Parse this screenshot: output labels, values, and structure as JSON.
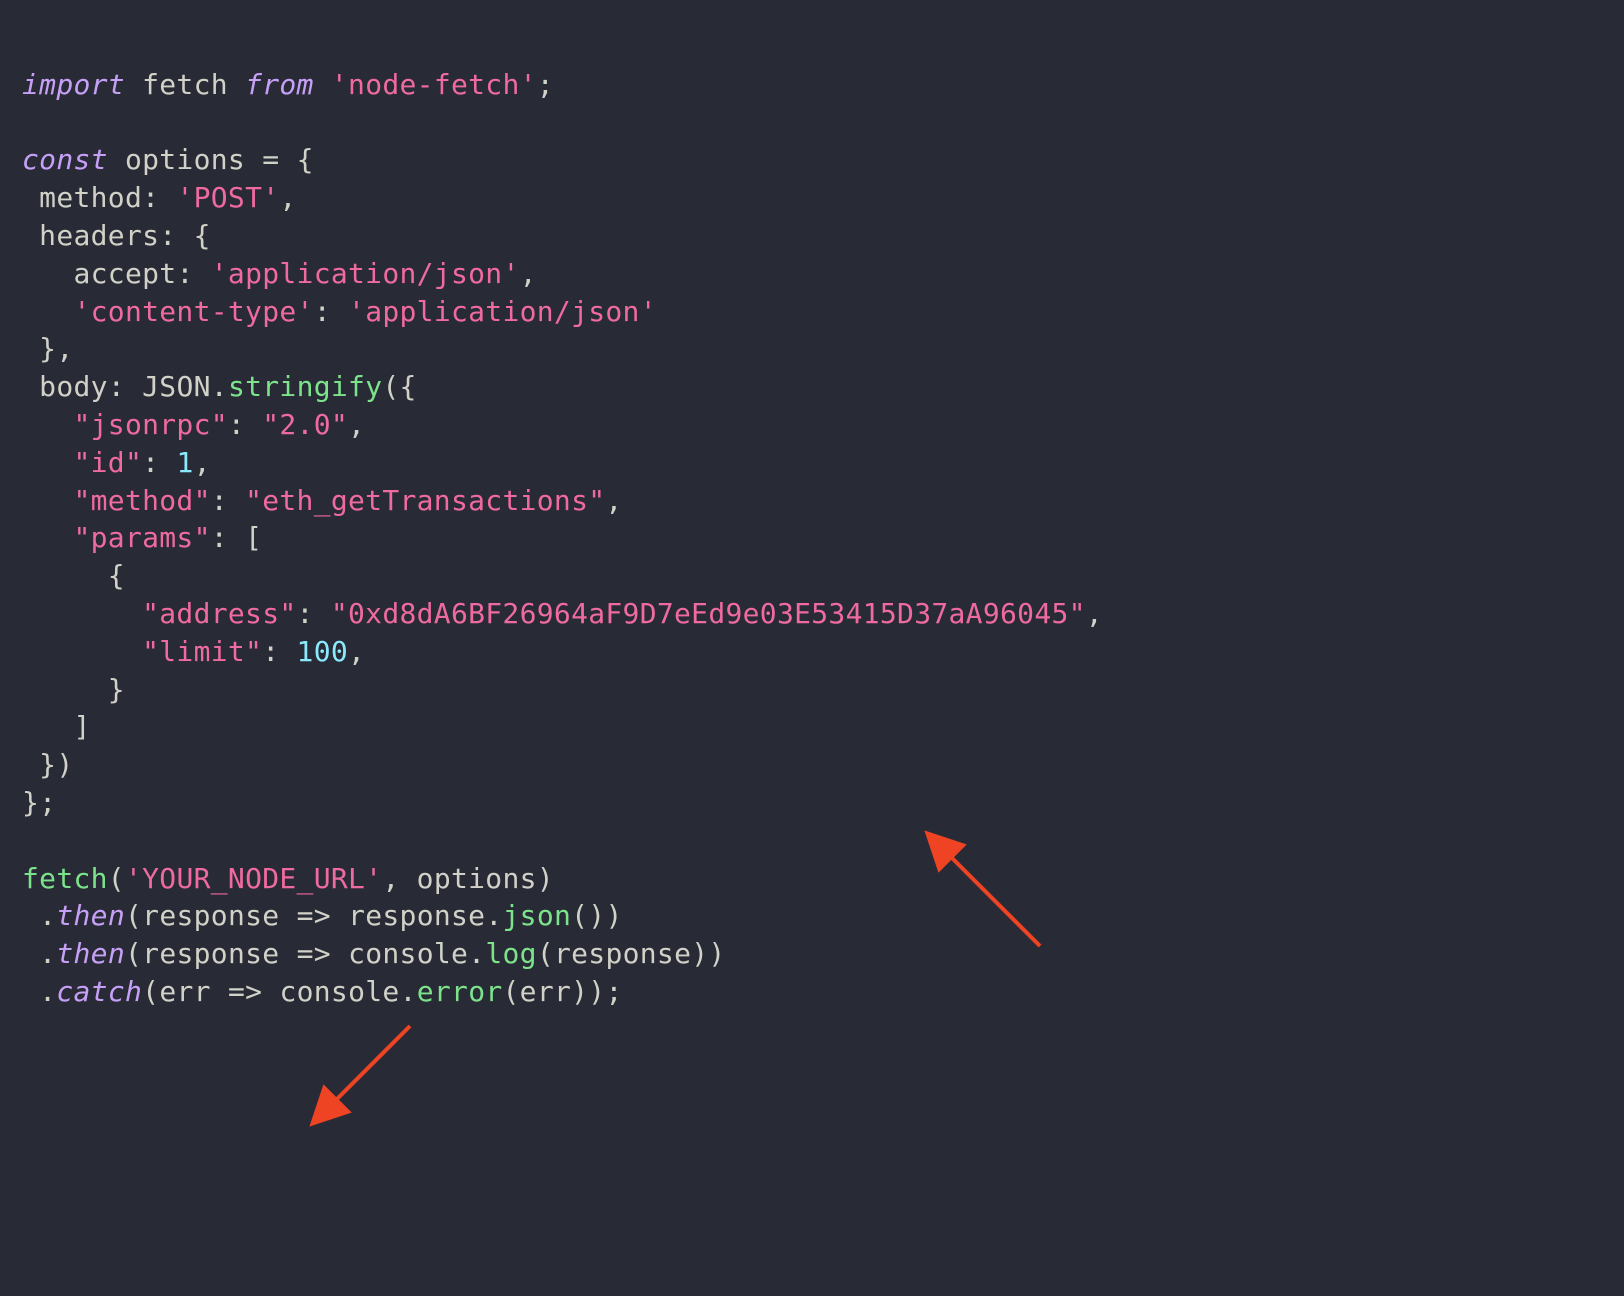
{
  "code": {
    "l1": {
      "kw": "import",
      "id": " fetch ",
      "from": "from",
      "sp": " ",
      "str": "'node-fetch'",
      "end": ";"
    },
    "l3": {
      "kw": "const",
      "id": " options ",
      "eq": "=",
      "sp": " ",
      "brace": "{"
    },
    "l4": {
      "indent": " ",
      "key": "method",
      "colon": ": ",
      "str": "'POST'",
      "comma": ","
    },
    "l5": {
      "indent": " ",
      "key": "headers",
      "colon": ": ",
      "brace": "{"
    },
    "l6": {
      "indent": "   ",
      "key": "accept",
      "colon": ": ",
      "str": "'application/json'",
      "comma": ","
    },
    "l7": {
      "indent": "   ",
      "key": "'content-type'",
      "colon": ": ",
      "str": "'application/json'"
    },
    "l8": {
      "indent": " ",
      "brace": "},",
      "": ""
    },
    "l9": {
      "indent": " ",
      "key": "body",
      "colon": ": ",
      "json": "JSON",
      "dot": ".",
      "fn": "stringify",
      "paren": "({"
    },
    "l10": {
      "indent": "   ",
      "key": "\"jsonrpc\"",
      "colon": ": ",
      "str": "\"2.0\"",
      "comma": ","
    },
    "l11": {
      "indent": "   ",
      "key": "\"id\"",
      "colon": ": ",
      "num": "1",
      "comma": ","
    },
    "l12": {
      "indent": "   ",
      "key": "\"method\"",
      "colon": ": ",
      "str": "\"eth_getTransactions\"",
      "comma": ","
    },
    "l13": {
      "indent": "   ",
      "key": "\"params\"",
      "colon": ": ",
      "bracket": "["
    },
    "l14": {
      "indent": "     ",
      "brace": "{"
    },
    "l15": {
      "indent": "       ",
      "key": "\"address\"",
      "colon": ": ",
      "str": "\"0xd8dA6BF26964aF9D7eEd9e03E53415D37aA96045\"",
      "comma": ","
    },
    "l16": {
      "indent": "       ",
      "key": "\"limit\"",
      "colon": ": ",
      "num": "100",
      "comma": ","
    },
    "l17": {
      "indent": "     ",
      "brace": "}"
    },
    "l18": {
      "indent": "   ",
      "bracket": "]"
    },
    "l19": {
      "indent": " ",
      "close": "})"
    },
    "l20": {
      "close": "};"
    },
    "l22": {
      "fn": "fetch",
      "paren": "(",
      "str": "'YOUR_NODE_URL'",
      "comma": ", ",
      "id": "options",
      "paren2": ")"
    },
    "l23": {
      "indent": " ",
      "dot": ".",
      "then": "then",
      "paren": "(",
      "id": "response ",
      "arrow": "=>",
      "id2": " response",
      "dot2": ".",
      "fn": "json",
      "paren2": "())"
    },
    "l24": {
      "indent": " ",
      "dot": ".",
      "then": "then",
      "paren": "(",
      "id": "response ",
      "arrow": "=>",
      "id2": " console",
      "dot2": ".",
      "fn": "log",
      "paren2": "(response))"
    },
    "l25": {
      "indent": " ",
      "dot": ".",
      "catch": "catch",
      "paren": "(",
      "id": "err ",
      "arrow": "=>",
      "id2": " console",
      "dot2": ".",
      "fn": "error",
      "paren2": "(err));"
    }
  },
  "annotations": {
    "arrow1": {
      "points_to": "address-string",
      "color": "#ef4423"
    },
    "arrow2": {
      "points_to": "your-node-url-string",
      "color": "#ef4423"
    }
  }
}
